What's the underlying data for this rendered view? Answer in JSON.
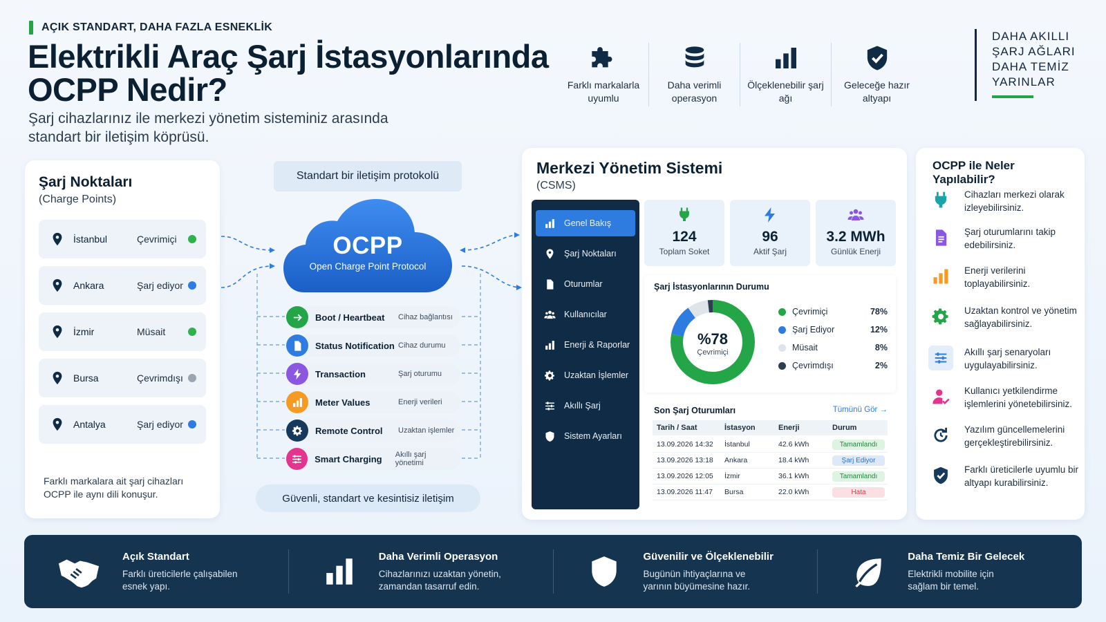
{
  "header": {
    "kicker": "AÇIK STANDART, DAHA FAZLA ESNEKLİK",
    "title": "Elektrikli Araç Şarj İstasyonlarında OCPP Nedir?",
    "subtitle": "Şarj cihazlarınız ile merkezi yönetim sisteminiz arasında standart bir iletişim köprüsü."
  },
  "features": [
    {
      "icon": "puzzle-icon",
      "label": "Farklı markalarla uyumlu"
    },
    {
      "icon": "database-icon",
      "label": "Daha verimli operasyon"
    },
    {
      "icon": "bar-chart-icon",
      "label": "Ölçeklenebilir şarj ağı"
    },
    {
      "icon": "shield-check-icon",
      "label": "Geleceğe hazır altyapı"
    }
  ],
  "tagline": [
    "DAHA AKILLI",
    "ŞARJ AĞLARI",
    "DAHA TEMİZ",
    "YARINLAR"
  ],
  "charge_points": {
    "title": "Şarj Noktaları",
    "subtitle": "(Charge Points)",
    "items": [
      {
        "city": "İstanbul",
        "status": "Çevrimiçi",
        "color": "#2fb24c"
      },
      {
        "city": "Ankara",
        "status": "Şarj ediyor",
        "color": "#2e7ce0"
      },
      {
        "city": "İzmir",
        "status": "Müsait",
        "color": "#2fb24c"
      },
      {
        "city": "Bursa",
        "status": "Çevrimdışı",
        "color": "#9aa5b1"
      },
      {
        "city": "Antalya",
        "status": "Şarj ediyor",
        "color": "#2e7ce0"
      }
    ],
    "note_line1": "Farklı markalara ait şarj cihazları",
    "note_line2": "OCPP ile aynı dili konuşur."
  },
  "protocol": {
    "top_label": "Standart bir iletişim protokolü",
    "name": "OCPP",
    "full_name": "Open Charge Point Protocol",
    "messages": [
      {
        "name": "Boot / Heartbeat",
        "desc": "Cihaz bağlantısı",
        "color": "#23a548",
        "icon": "arrow-icon"
      },
      {
        "name": "Status Notification",
        "desc": "Cihaz durumu",
        "color": "#2e7ce0",
        "icon": "document-icon"
      },
      {
        "name": "Transaction",
        "desc": "Şarj oturumu",
        "color": "#8b56e0",
        "icon": "bolt-icon"
      },
      {
        "name": "Meter Values",
        "desc": "Enerji verileri",
        "color": "#f59a22",
        "icon": "bar-chart-icon"
      },
      {
        "name": "Remote Control",
        "desc": "Uzaktan işlemler",
        "color": "#163a5c",
        "icon": "gear-icon"
      },
      {
        "name": "Smart Charging",
        "desc": "Akıllı şarj yönetimi",
        "color": "#e2368e",
        "icon": "sliders-icon"
      }
    ],
    "bottom_label": "Güvenli, standart ve kesintisiz iletişim"
  },
  "csms": {
    "title": "Merkezi Yönetim Sistemi",
    "subtitle": "(CSMS)",
    "nav": [
      {
        "label": "Genel Bakış",
        "icon": "bar-chart-icon",
        "active": true
      },
      {
        "label": "Şarj Noktaları",
        "icon": "pin-icon"
      },
      {
        "label": "Oturumlar",
        "icon": "document-icon"
      },
      {
        "label": "Kullanıcılar",
        "icon": "users-icon"
      },
      {
        "label": "Enerji & Raporlar",
        "icon": "bar-chart-icon"
      },
      {
        "label": "Uzaktan İşlemler",
        "icon": "gear-icon"
      },
      {
        "label": "Akıllı Şarj",
        "icon": "sliders-icon"
      },
      {
        "label": "Sistem Ayarları",
        "icon": "shield-check-icon"
      }
    ],
    "stats": [
      {
        "value": "124",
        "label": "Toplam Soket",
        "icon": "plug-icon",
        "color": "#23a548"
      },
      {
        "value": "96",
        "label": "Aktif Şarj",
        "icon": "bolt-icon",
        "color": "#2e7ce0"
      },
      {
        "value": "3.2 MWh",
        "label": "Günlük Enerji",
        "icon": "users-icon",
        "color": "#8b56e0"
      }
    ],
    "status_panel": {
      "title": "Şarj İstasyonlarının Durumu",
      "center_value": "%78",
      "center_label": "Çevrimiçi"
    },
    "sessions": {
      "title": "Son Şarj Oturumları",
      "view_all": "Tümünü Gör →",
      "headers": [
        "Tarih / Saat",
        "İstasyon",
        "Enerji",
        "Durum"
      ],
      "rows": [
        {
          "date": "13.09.2026 14:32",
          "station": "İstanbul",
          "energy": "42.6 kWh",
          "status": "Tamamlandı",
          "bg": "#dff3e3",
          "fg": "#1e8a3c"
        },
        {
          "date": "13.09.2026 13:18",
          "station": "Ankara",
          "energy": "18.4 kWh",
          "status": "Şarj Ediyor",
          "bg": "#dde9f9",
          "fg": "#2e6fcc"
        },
        {
          "date": "13.09.2026 12:05",
          "station": "İzmir",
          "energy": "36.1 kWh",
          "status": "Tamamlandı",
          "bg": "#dff3e3",
          "fg": "#1e8a3c"
        },
        {
          "date": "13.09.2026 11:47",
          "station": "Bursa",
          "energy": "22.0 kWh",
          "status": "Hata",
          "bg": "#fbe0e3",
          "fg": "#d8394f"
        }
      ]
    }
  },
  "chart_data": {
    "type": "pie",
    "title": "Şarj İstasyonlarının Durumu",
    "categories": [
      "Çevrimiçi",
      "Şarj Ediyor",
      "Müsait",
      "Çevrimdışı"
    ],
    "values": [
      78,
      12,
      8,
      2
    ],
    "value_labels": [
      "78%",
      "12%",
      "8%",
      "2%"
    ],
    "colors": [
      "#23a548",
      "#2e7ce0",
      "#dfe4ea",
      "#2d3e50"
    ],
    "legend_position": "right"
  },
  "capabilities": {
    "title": "OCPP ile Neler Yapılabilir?",
    "items": [
      {
        "text": "Cihazları merkezi olarak izleyebilirsiniz.",
        "icon": "plug-icon",
        "color": "#1aa3a8"
      },
      {
        "text": "Şarj oturumlarını takip edebilirsiniz.",
        "icon": "document-icon",
        "color": "#8b56e0"
      },
      {
        "text": "Enerji verilerini toplayabilirsiniz.",
        "icon": "bar-chart-icon",
        "color": "#f59a22"
      },
      {
        "text": "Uzaktan kontrol ve yönetim sağlayabilirsiniz.",
        "icon": "gear-icon",
        "color": "#23a548"
      },
      {
        "text": "Akıllı şarj senaryoları uygulayabilirsiniz.",
        "icon": "sliders-icon",
        "color": "#2e7ce0"
      },
      {
        "text": "Kullanıcı yetkilendirme işlemlerini yönetebilirsiniz.",
        "icon": "user-check-icon",
        "color": "#e2368e"
      },
      {
        "text": "Yazılım güncellemelerini gerçekleştirebilirsiniz.",
        "icon": "refresh-icon",
        "color": "#163a5c"
      },
      {
        "text": "Farklı üreticilerle uyumlu bir altyapı kurabilirsiniz.",
        "icon": "shield-check-icon",
        "color": "#163a5c"
      }
    ]
  },
  "banner": [
    {
      "title": "Açık Standart",
      "desc1": "Farklı üreticilerle çalışabilen",
      "desc2": "esnek yapı.",
      "icon": "handshake-icon"
    },
    {
      "title": "Daha Verimli Operasyon",
      "desc1": "Cihazlarınızı uzaktan yönetin,",
      "desc2": "zamandan tasarruf edin.",
      "icon": "bar-chart-icon"
    },
    {
      "title": "Güvenilir ve Ölçeklenebilir",
      "desc1": "Bugünün ihtiyaçlarına ve",
      "desc2": "yarının büyümesine hazır.",
      "icon": "shield-check-icon"
    },
    {
      "title": "Daha Temiz Bir Gelecek",
      "desc1": "Elektrikli mobilite için",
      "desc2": "sağlam bir temel.",
      "icon": "leaf-icon"
    }
  ]
}
